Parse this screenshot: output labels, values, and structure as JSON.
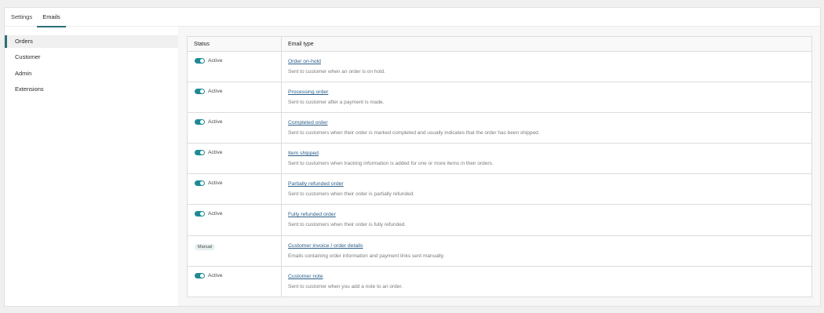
{
  "tabs": [
    {
      "label": "Settings",
      "active": false
    },
    {
      "label": "Emails",
      "active": true
    }
  ],
  "sidebar": {
    "items": [
      {
        "label": "Orders",
        "active": true
      },
      {
        "label": "Customer",
        "active": false
      },
      {
        "label": "Admin",
        "active": false
      },
      {
        "label": "Extensions",
        "active": false
      }
    ]
  },
  "table": {
    "headers": {
      "status": "Status",
      "email_type": "Email type"
    },
    "rows": [
      {
        "status_type": "toggle",
        "status_label": "Active",
        "title": "Order on-hold",
        "description": "Sent to customer when an order is on hold."
      },
      {
        "status_type": "toggle",
        "status_label": "Active",
        "title": "Processing order",
        "description": "Sent to customer after a payment is made."
      },
      {
        "status_type": "toggle",
        "status_label": "Active",
        "title": "Completed order",
        "description": "Sent to customers when their order is marked completed and usually indicates that the order has been shipped."
      },
      {
        "status_type": "toggle",
        "status_label": "Active",
        "title": "Item shipped",
        "description": "Sent to customers when tracking information is added for one or more items in their orders."
      },
      {
        "status_type": "toggle",
        "status_label": "Active",
        "title": "Partially refunded order",
        "description": "Sent to customers when their order is partially refunded."
      },
      {
        "status_type": "toggle",
        "status_label": "Active",
        "title": "Fully refunded order",
        "description": "Sent to customers when their order is fully refunded."
      },
      {
        "status_type": "badge",
        "status_label": "Manual",
        "title": "Customer invoice / order details",
        "description": "Emails containing order information and payment links sent manually."
      },
      {
        "status_type": "toggle",
        "status_label": "Active",
        "title": "Customer note",
        "description": "Sent to customer when you add a note to an order."
      }
    ]
  },
  "colors": {
    "accent": "#2b6f77",
    "toggle_on": "#1e8a95",
    "link": "#2b5f8a"
  }
}
